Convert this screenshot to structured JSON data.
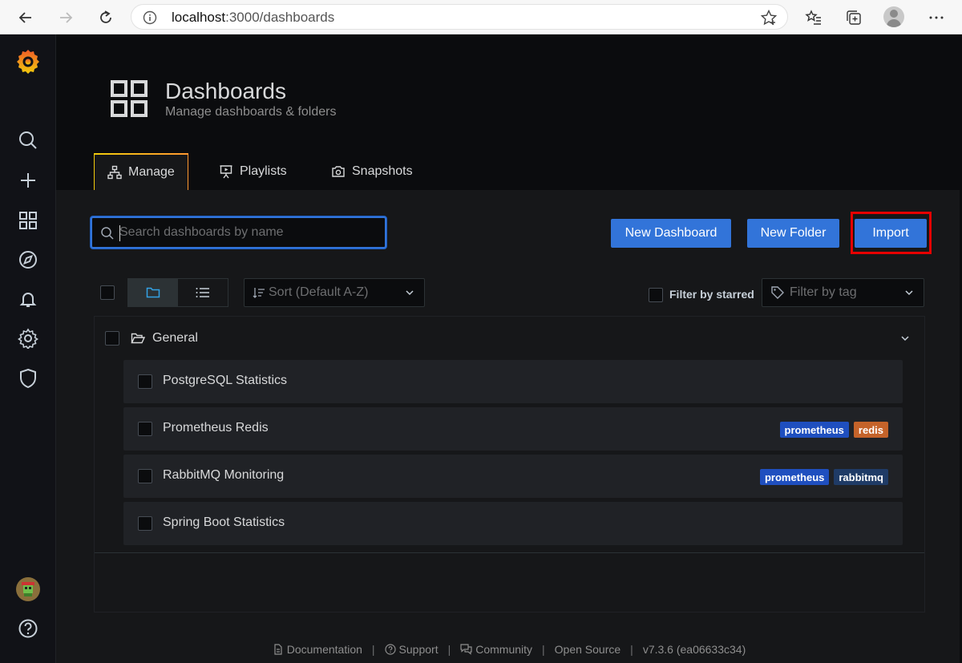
{
  "browser": {
    "url_host": "localhost",
    "url_path": ":3000/dashboards"
  },
  "header": {
    "title": "Dashboards",
    "subtitle": "Manage dashboards & folders"
  },
  "tabs": [
    {
      "label": "Manage",
      "active": true
    },
    {
      "label": "Playlists",
      "active": false
    },
    {
      "label": "Snapshots",
      "active": false
    }
  ],
  "actions": {
    "search_placeholder": "Search dashboards by name",
    "new_dashboard": "New Dashboard",
    "new_folder": "New Folder",
    "import": "Import"
  },
  "filters": {
    "sort_label": "Sort (Default A-Z)",
    "starred_label": "Filter by starred",
    "tag_placeholder": "Filter by tag"
  },
  "folder": {
    "name": "General",
    "items": [
      {
        "name": "PostgreSQL Statistics",
        "tags": []
      },
      {
        "name": "Prometheus Redis",
        "tags": [
          {
            "label": "prometheus",
            "color": "#1f4fbf"
          },
          {
            "label": "redis",
            "color": "#c4632a"
          }
        ]
      },
      {
        "name": "RabbitMQ Monitoring",
        "tags": [
          {
            "label": "prometheus",
            "color": "#1f4fbf"
          },
          {
            "label": "rabbitmq",
            "color": "#1f3b66"
          }
        ]
      },
      {
        "name": "Spring Boot Statistics",
        "tags": []
      }
    ]
  },
  "footer": {
    "documentation": "Documentation",
    "support": "Support",
    "community": "Community",
    "open_source": "Open Source",
    "version": "v7.3.6 (ea06633c34)"
  },
  "colors": {
    "primary": "#3274d9",
    "highlight": "#e60000",
    "accent_gradient_start": "#f2cc0c",
    "accent_gradient_end": "#ff9830"
  }
}
